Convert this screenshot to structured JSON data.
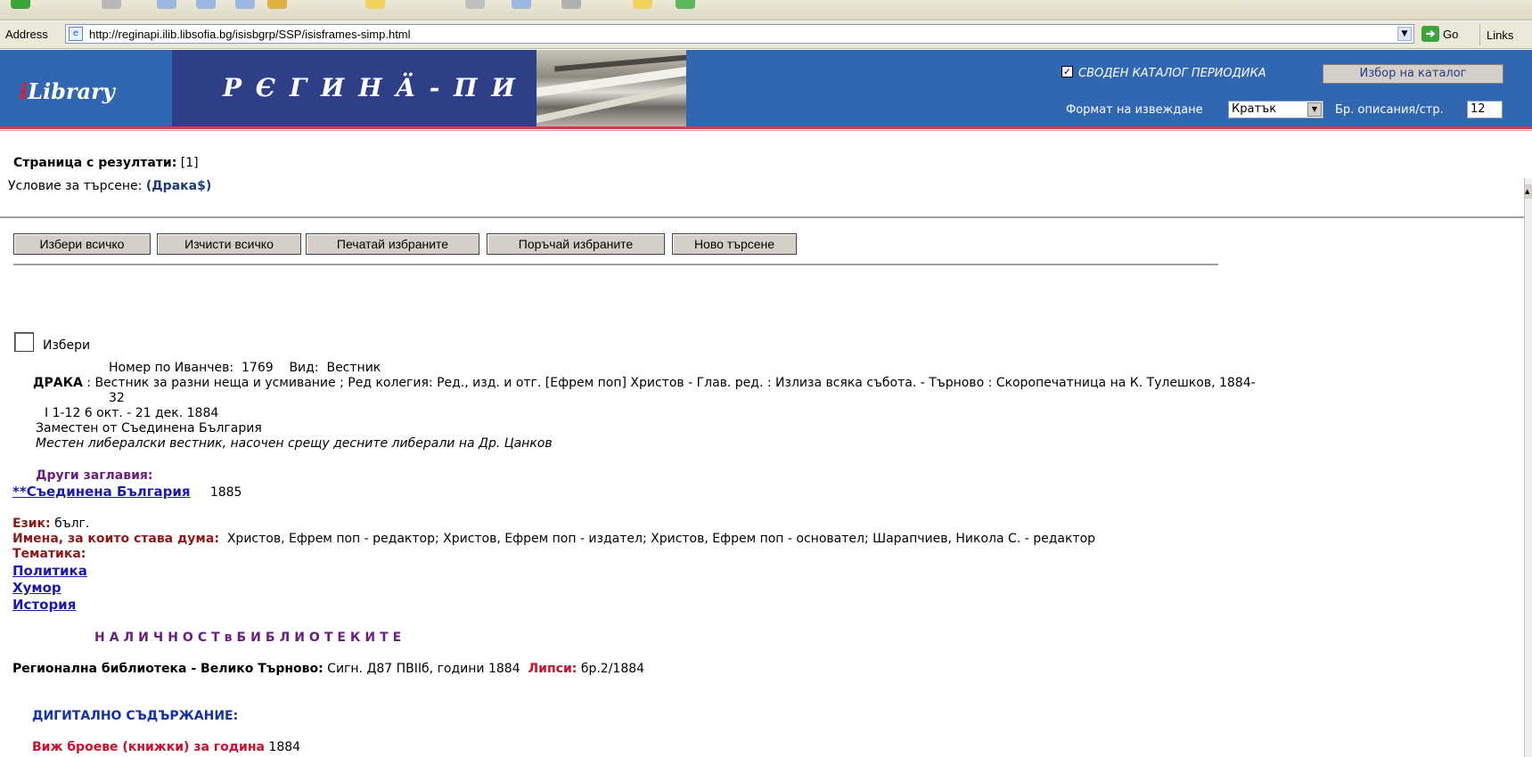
{
  "browser": {
    "address_label": "Address",
    "url": "http://reginapi.ilib.libsofia.bg/isisbgrp/SSP/isisframes-simp.html",
    "go_label": "Go",
    "links_label": "Links"
  },
  "banner": {
    "logo_i": "i",
    "logo_text": "Library",
    "title": "Р Є Г И Н Ä - П И",
    "catalog_label": "СВОДЕН КАТАЛОГ ПЕРИОДИКА",
    "catalog_checked": true,
    "catalog_button": "Избор на каталог",
    "format_label": "Формат на извеждане",
    "format_value": "Кратък",
    "per_page_label": "Бр. описания/стр.",
    "per_page_value": "12",
    "colors": {
      "banner": "#3067b0",
      "title_box": "#2e3f88",
      "red_line": "#d6384c"
    }
  },
  "results": {
    "pages_label": "Страница с резултати:",
    "pages_value": "[1]",
    "condition_label": "Условие за търсене:",
    "condition_value": "(Драка$)"
  },
  "buttons": {
    "select_all": "Избери всичко",
    "clear_all": "Изчисти всичко",
    "print_selected": "Печатай избраните",
    "order_selected": "Поръчай избраните",
    "new_search": "Ново търсене"
  },
  "record": {
    "select_label": "Избери",
    "number_label": "Номер по Иванчев:",
    "number_value": "1769",
    "type_label": "Вид:",
    "type_value": "Вестник",
    "title": "ДРАКА",
    "description": ": Вестник за разни неща и усмивание ; Ред колегия: Ред., изд. и отг. [Ефрем поп] Христов - Глав. ред. : Излиза всяка събота. - Търново : Скоропечатница на К. Тулешков, 1884-",
    "description_cont": "32",
    "issues": "I 1-12 6 окт. - 21 дек. 1884",
    "replaced_by": "Заместен от Съединена България",
    "note": "Местен либералски вестник, насочен срещу десните либерали на Др. Цанков",
    "other_titles_label": "Други заглавия:",
    "other_title_link": "**Съединена България",
    "other_title_year": "1885",
    "language_label": "Език:",
    "language_value": "бълг.",
    "names_label": "Имена, за които става дума:",
    "names_value": "Христов, Ефрем поп - редактор; Христов, Ефрем поп - издател; Христов, Ефрем поп - основател; Шарапчиев, Никола С. - редактор",
    "subjects_label": "Тематика:",
    "subjects": [
      "Политика",
      "Хумор",
      "История"
    ],
    "holdings_heading": "НАЛИЧНОСТвБИБЛИОТЕКИТЕ",
    "library_name": "Регионална библиотека - Велико Търново:",
    "library_holdings": "Сигн. Д87 ПВІІб, години 1884",
    "missing_label": "Липси:",
    "missing_value": "бр.2/1884",
    "digital_heading": "ДИГИТАЛНО СЪДЪРЖАНИЕ:",
    "issues_for_year_label": "Виж броеве (книжки) за година",
    "issues_for_year_value": "1884"
  }
}
